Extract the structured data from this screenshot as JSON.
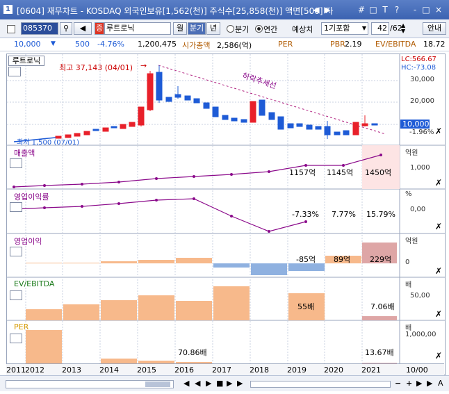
{
  "window": {
    "icon_label": "1",
    "title": "[0604] 재무차트 - KOSDAQ 외국인보유[1,562(천)] 주식수[25,858(천)] 액면[500] 자",
    "controls": [
      "◀",
      "▶",
      "#",
      "□",
      "T",
      "?",
      "-",
      "□",
      "×"
    ]
  },
  "toolbar": {
    "code": "085370",
    "stock_tag": "증",
    "stock_name": "루트로닉",
    "btn_month": "월",
    "btn_quarter": "분기",
    "btn_year": "년",
    "radio_quarter": "분기",
    "radio_annual": "연간",
    "estimate_label": "예상치",
    "estimate_value": "1기포함",
    "page": "42",
    "page_total": "/62",
    "guide": "안내"
  },
  "inforow": {
    "price": "10,000",
    "change": "500",
    "pct": "-4.76%",
    "volume": "1,200,475",
    "mktcap_label": "시가총액",
    "mktcap": "2,586(억)",
    "per_label": "PER",
    "pbr_label": "PBR",
    "pbr": "2.19",
    "ev_label": "EV/EBITDA",
    "ev": "18.72"
  },
  "price_panel": {
    "name": "루트로닉",
    "high_label": "최고 37,143 (04/01)",
    "low_label": "최저 1,500 (07/01)",
    "trend_label": "하락추세선",
    "lc": "LC:566.67",
    "hc": "HC:-73.08",
    "scale": [
      "30,000",
      "20,000",
      "10,000",
      "-1.96%"
    ],
    "current": "10,000"
  },
  "revenue": {
    "label": "매출액",
    "unit": "억원",
    "scale": "1,000",
    "values": [
      "1157억",
      "1145억",
      "1450억"
    ]
  },
  "margin": {
    "label": "영업이익률",
    "unit": "%",
    "scale": "0,00",
    "values": [
      "-7.33%",
      "7.77%",
      "15.79%"
    ]
  },
  "oper": {
    "label": "영업이익",
    "unit": "억원",
    "scale": "0",
    "values": [
      "-85억",
      "89억",
      "229억"
    ]
  },
  "ev": {
    "label": "EV/EBITDA",
    "unit": "배",
    "scale": "50,00",
    "values": [
      "55배",
      "7.06배"
    ]
  },
  "per": {
    "label": "PER",
    "unit": "배",
    "scale": "1,000,00",
    "values": [
      "70.86배",
      "13.67배"
    ]
  },
  "xaxis": [
    "2011",
    "2012",
    "2013",
    "2014",
    "2015",
    "2016",
    "2017",
    "2018",
    "2019",
    "2020",
    "2021",
    "10/00"
  ],
  "colors": {
    "up": "#e8202a",
    "down": "#1e5bd6",
    "bar": "#f7b98b",
    "neg": "#8fb1e0",
    "line": "#8b0a8b"
  }
}
